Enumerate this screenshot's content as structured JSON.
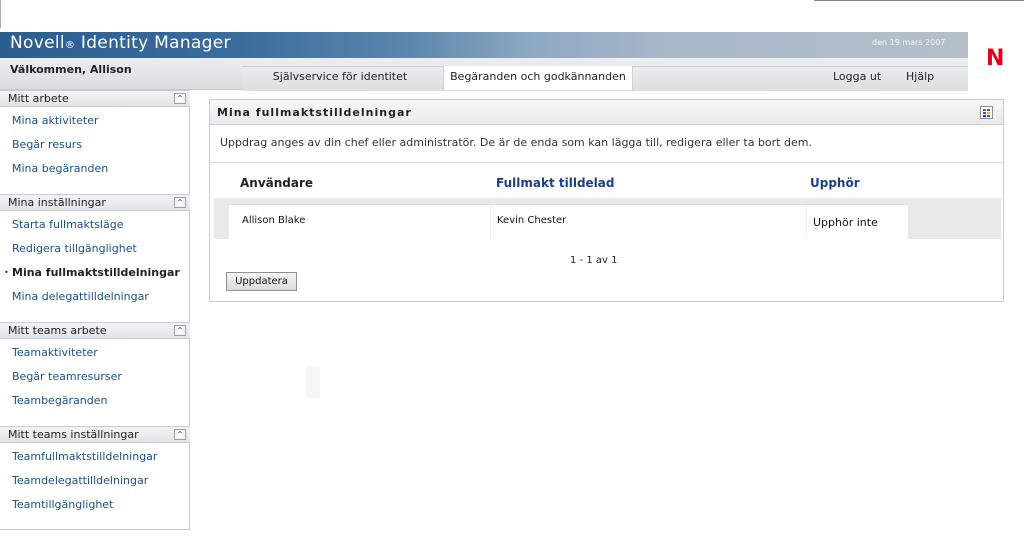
{
  "header": {
    "app_name": "Novell",
    "registered_mark": "®",
    "app_product": " Identity Manager",
    "date": "den 19 mars 2007",
    "logo_letter": "N",
    "welcome": "Välkommen, Allison"
  },
  "tabs": [
    {
      "label": "Självservice för identitet",
      "active": false
    },
    {
      "label": "Begäranden och godkännanden",
      "active": true
    }
  ],
  "top_links": {
    "logout": "Logga ut",
    "help": "Hjälp"
  },
  "sidebar": {
    "sections": [
      {
        "title": "Mitt arbete",
        "items": [
          "Mina aktiviteter",
          "Begär resurs",
          "Mina begäranden"
        ]
      },
      {
        "title": "Mina inställningar",
        "items": [
          "Starta fullmaktsläge",
          "Redigera tillgänglighet",
          "Mina fullmaktstilldelningar",
          "Mina delegattilldelningar"
        ],
        "active_index": 2
      },
      {
        "title": "Mitt teams arbete",
        "items": [
          "Teamaktiviteter",
          "Begär teamresurser",
          "Teambegäranden"
        ]
      },
      {
        "title": "Mitt teams inställningar",
        "items": [
          "Teamfullmaktstilldelningar",
          "Teamdelegattilldelningar",
          "Teamtillgänglighet"
        ]
      }
    ],
    "collapse_glyph": "⌃"
  },
  "panel": {
    "title": "Mina fullmaktstilldelningar",
    "description": "Uppdrag anges av din chef eller administratör. De är de enda som kan lägga till, redigera eller ta bort dem.",
    "columns": {
      "user": "Användare",
      "proxy": "Fullmakt tilldelad",
      "expires": "Upphör"
    },
    "rows": [
      {
        "user": "Allison Blake",
        "proxy": "Kevin Chester",
        "expires": "Upphör inte"
      }
    ],
    "pager": "1 - 1 av 1",
    "update_button": "Uppdatera"
  },
  "colors": {
    "accent_red": "#e3001b",
    "header_blue": "#2b5d8f",
    "link_blue": "#1a4f8b"
  }
}
